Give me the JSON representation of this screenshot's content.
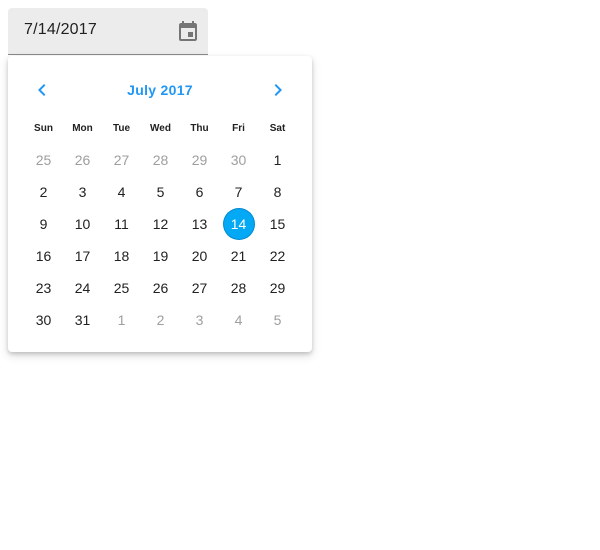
{
  "date_field": {
    "value": "7/14/2017",
    "icon": "calendar-icon"
  },
  "calendar": {
    "month_label": "July 2017",
    "prev_icon": "chevron-left-icon",
    "next_icon": "chevron-right-icon",
    "accent_color": "#2196f3",
    "selected_color": "#03a9f4",
    "weekdays": [
      "Sun",
      "Mon",
      "Tue",
      "Wed",
      "Thu",
      "Fri",
      "Sat"
    ],
    "weeks": [
      [
        "25",
        "26",
        "27",
        "28",
        "29",
        "30",
        "1"
      ],
      [
        "2",
        "3",
        "4",
        "5",
        "6",
        "7",
        "8"
      ],
      [
        "9",
        "10",
        "11",
        "12",
        "13",
        "14",
        "15"
      ],
      [
        "16",
        "17",
        "18",
        "19",
        "20",
        "21",
        "22"
      ],
      [
        "23",
        "24",
        "25",
        "26",
        "27",
        "28",
        "29"
      ],
      [
        "30",
        "31",
        "1",
        "2",
        "3",
        "4",
        "5"
      ]
    ],
    "selected_day": "14"
  }
}
